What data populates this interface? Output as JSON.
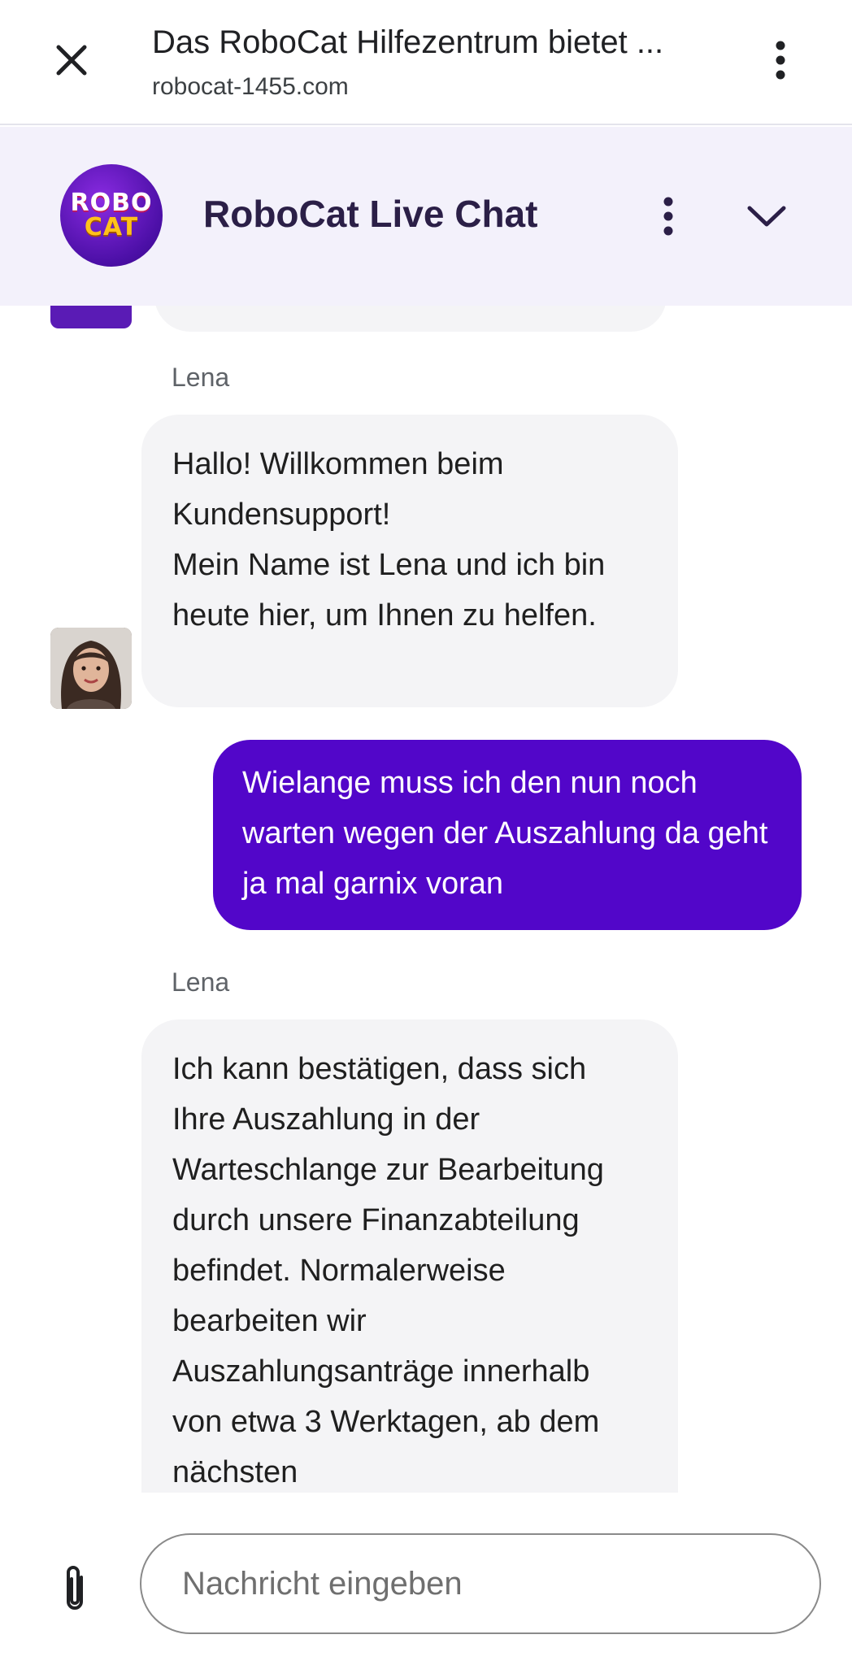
{
  "browser": {
    "page_title": "Das RoboCat Hilfezentrum bietet ...",
    "url": "robocat-1455.com",
    "icons": {
      "close": "close-icon",
      "menu": "more-vert-icon"
    }
  },
  "chat_header": {
    "logo_line1": "ROBO",
    "logo_line2": "CAT",
    "title": "RoboCat Live Chat",
    "icons": {
      "menu": "more-vert-icon",
      "collapse": "chevron-down-icon"
    }
  },
  "messages": [
    {
      "sender": "Lena",
      "direction": "incoming",
      "text": "Hallo! Willkommen beim Kundensupport!\nMein Name ist Lena und ich bin heute hier, um Ihnen zu helfen."
    },
    {
      "direction": "outgoing",
      "text": "Wielange muss ich den nun noch warten wegen der Auszahlung da geht ja mal garnix voran"
    },
    {
      "sender": "Lena",
      "direction": "incoming",
      "text": "Ich kann bestätigen, dass sich Ihre Auszahlung in der Warteschlange zur Bearbeitung durch unsere Finanzabteilung befindet. Normalerweise bearbeiten wir Auszahlungsanträge innerhalb von etwa 3 Werktagen, ab dem nächsten"
    }
  ],
  "composer": {
    "placeholder": "Nachricht eingeben",
    "value": "",
    "icons": {
      "attach": "paperclip-icon"
    }
  },
  "colors": {
    "accent": "#5206c9",
    "header_bg": "#f3f1fb",
    "incoming_bubble": "#f4f4f6"
  }
}
